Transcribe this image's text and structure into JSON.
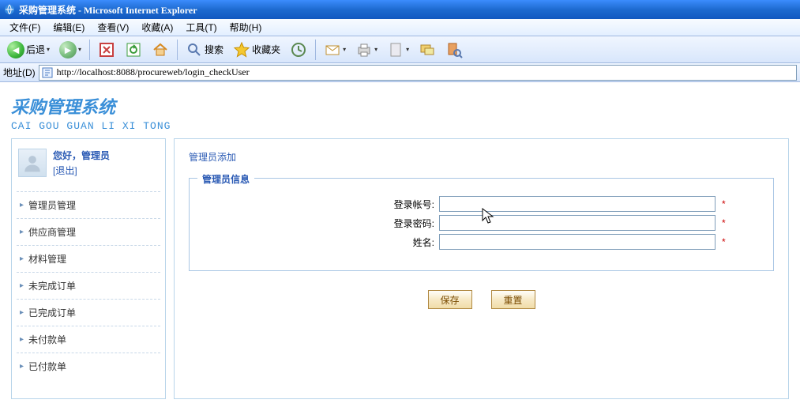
{
  "window": {
    "title": "采购管理系统 - Microsoft Internet Explorer"
  },
  "menubar": {
    "file": "文件(F)",
    "edit": "编辑(E)",
    "view": "查看(V)",
    "favorites": "收藏(A)",
    "tools": "工具(T)",
    "help": "帮助(H)"
  },
  "toolbar": {
    "back": "后退",
    "search": "搜索",
    "favorites": "收藏夹"
  },
  "addressbar": {
    "label": "地址(D)",
    "url": "http://localhost:8088/procureweb/login_checkUser"
  },
  "page": {
    "title": "采购管理系统",
    "subtitle": "CAI GOU GUAN LI XI TONG"
  },
  "sidebar": {
    "greeting_prefix": "您好，",
    "username": "管理员",
    "logout": "[退出]",
    "items": [
      {
        "label": "管理员管理"
      },
      {
        "label": "供应商管理"
      },
      {
        "label": "材料管理"
      },
      {
        "label": "未完成订单"
      },
      {
        "label": "已完成订单"
      },
      {
        "label": "未付款单"
      },
      {
        "label": "已付款单"
      }
    ]
  },
  "main": {
    "breadcrumb": "管理员添加",
    "fieldset_legend": "管理员信息",
    "fields": {
      "account_label": "登录帐号:",
      "account_value": "",
      "password_label": "登录密码:",
      "password_value": "",
      "name_label": "姓名:",
      "name_value": "",
      "required_mark": "*"
    },
    "buttons": {
      "save": "保存",
      "reset": "重置"
    }
  }
}
